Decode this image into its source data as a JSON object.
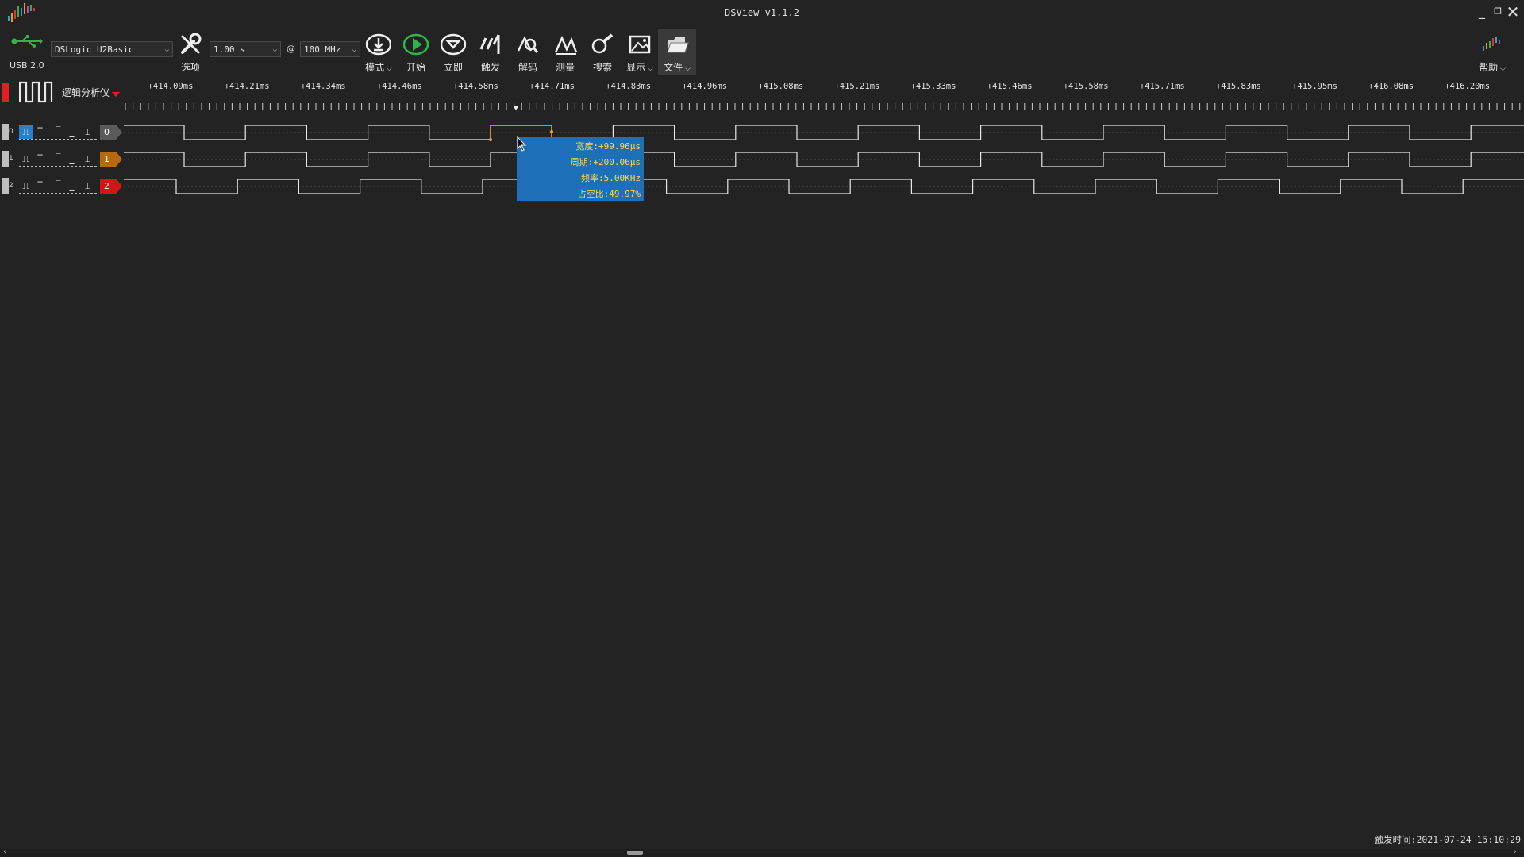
{
  "window": {
    "title": "DSView v1.1.2"
  },
  "toolbar": {
    "usb_label": "USB 2.0",
    "device": "DSLogic U2Basic",
    "duration": "1.00 s",
    "at_symbol": "@",
    "sample_rate": "100 MHz",
    "buttons": {
      "options": "选项",
      "mode": "模式",
      "start": "开始",
      "instant": "立即",
      "trigger": "触发",
      "decode": "解码",
      "measure": "测量",
      "search": "搜索",
      "display": "显示",
      "file": "文件",
      "help": "帮助"
    }
  },
  "panel": {
    "mode_label": "逻辑分析仪"
  },
  "ruler": {
    "labels": [
      "+414.09ms",
      "+414.21ms",
      "+414.34ms",
      "+414.46ms",
      "+414.58ms",
      "+414.71ms",
      "+414.83ms",
      "+414.96ms",
      "+415.08ms",
      "+415.21ms",
      "+415.33ms",
      "+415.46ms",
      "+415.58ms",
      "+415.71ms",
      "+415.83ms",
      "+415.95ms",
      "+416.08ms",
      "+416.20ms"
    ]
  },
  "channels": [
    {
      "index": "0",
      "tag": "0",
      "tag_color": "#5a5a5a"
    },
    {
      "index": "1",
      "tag": "1",
      "tag_color": "#b8680e"
    },
    {
      "index": "2",
      "tag": "2",
      "tag_color": "#d21414"
    }
  ],
  "tooltip": {
    "width": "宽度:+99.96μs",
    "period": "周期:+200.06μs",
    "frequency": "频率:5.00KHz",
    "duty": "占空比:49.97%"
  },
  "status": {
    "trigger_time": "触发时间:2021-07-24 15:10:29"
  }
}
